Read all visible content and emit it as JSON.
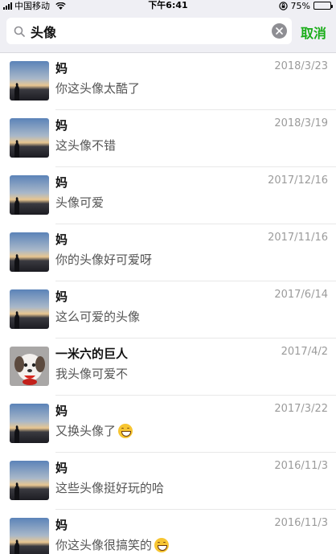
{
  "status_bar": {
    "carrier": "中国移动",
    "time": "下午6:41",
    "battery_text": "75%",
    "battery_level": 0.75
  },
  "search": {
    "query": "头像",
    "cancel_label": "取消"
  },
  "results": [
    {
      "name": "妈",
      "date": "2018/3/23",
      "message": "你这头像太酷了",
      "avatar": "sunset-silhouette",
      "emoji": false
    },
    {
      "name": "妈",
      "date": "2018/3/19",
      "message": "这头像不错",
      "avatar": "sunset-silhouette",
      "emoji": false
    },
    {
      "name": "妈",
      "date": "2017/12/16",
      "message": "头像可爱",
      "avatar": "sunset-silhouette",
      "emoji": false
    },
    {
      "name": "妈",
      "date": "2017/11/16",
      "message": "你的头像好可爱呀",
      "avatar": "sunset-silhouette",
      "emoji": false
    },
    {
      "name": "妈",
      "date": "2017/6/14",
      "message": "这么可爱的头像",
      "avatar": "sunset-silhouette",
      "emoji": false
    },
    {
      "name": "一米六的巨人",
      "date": "2017/4/2",
      "message": "我头像可爱不",
      "avatar": "cartoon-dog",
      "emoji": false
    },
    {
      "name": "妈",
      "date": "2017/3/22",
      "message": "又换头像了",
      "avatar": "sunset-silhouette",
      "emoji": true
    },
    {
      "name": "妈",
      "date": "2016/11/3",
      "message": "这些头像挺好玩的哈",
      "avatar": "sunset-silhouette",
      "emoji": false
    },
    {
      "name": "妈",
      "date": "2016/11/3",
      "message": "你这头像很搞笑的",
      "avatar": "sunset-silhouette",
      "emoji": true
    }
  ],
  "icons": {
    "search": "search-icon",
    "clear": "clear-icon",
    "emoji": "grinning-emoji-icon"
  },
  "colors": {
    "accent_green": "#1aad19",
    "header_bg": "#efeff4",
    "date_gray": "#9b9b9b",
    "message_gray": "#555555"
  }
}
